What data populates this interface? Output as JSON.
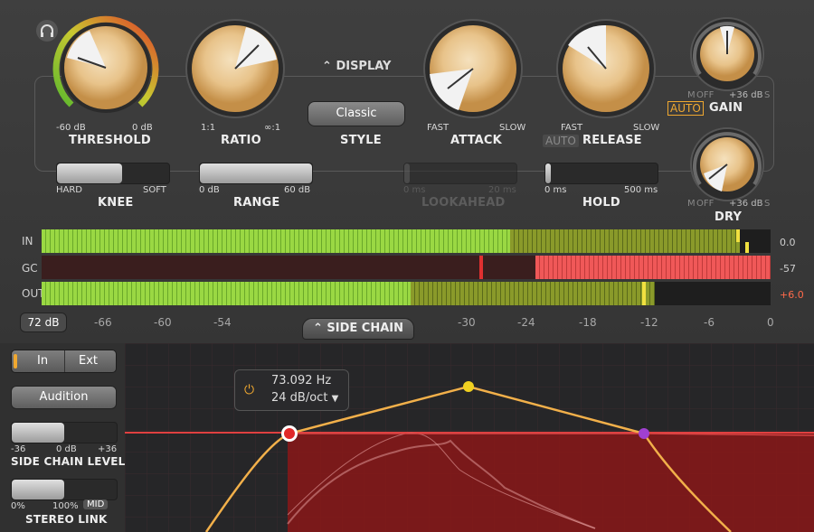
{
  "controls": {
    "threshold": {
      "label": "THRESHOLD",
      "min": "-60 dB",
      "max": "0 dB"
    },
    "ratio": {
      "label": "RATIO",
      "min": "1:1",
      "max": "∞:1"
    },
    "display_toggle": "DISPLAY",
    "style": {
      "label": "STYLE",
      "value": "Classic"
    },
    "attack": {
      "label": "ATTACK",
      "min": "FAST",
      "max": "SLOW"
    },
    "release": {
      "label": "RELEASE",
      "min": "FAST",
      "max": "SLOW",
      "auto": "AUTO"
    },
    "gain": {
      "label": "GAIN",
      "auto": "AUTO",
      "m": "M",
      "off": "OFF",
      "max": "+36 dB",
      "s": "S"
    },
    "dry": {
      "label": "DRY",
      "m": "M",
      "off": "OFF",
      "max": "+36 dB",
      "s": "S"
    },
    "knee": {
      "label": "KNEE",
      "min": "HARD",
      "max": "SOFT",
      "level": 0.6
    },
    "range": {
      "label": "RANGE",
      "min": "0 dB",
      "max": "60 dB",
      "level": 1.0
    },
    "lookahead": {
      "label": "LOOKAHEAD",
      "min": "0 ms",
      "max": "20 ms",
      "level": 0.0
    },
    "hold": {
      "label": "HOLD",
      "min": "0 ms",
      "max": "500 ms",
      "level": 0.0
    }
  },
  "meters": {
    "in": {
      "label": "IN",
      "value": "0.0",
      "level": 0.98
    },
    "gc": {
      "label": "GC",
      "value": "-57",
      "level": 0.57
    },
    "out": {
      "label": "OUT",
      "value": "+6.0",
      "level": 0.85
    },
    "range_button": "72 dB",
    "scale": [
      "-66",
      "-60",
      "-54",
      "-30",
      "-24",
      "-18",
      "-12",
      "-6",
      "0"
    ]
  },
  "side_chain": {
    "toggle": "SIDE CHAIN",
    "in": "In",
    "ext": "Ext",
    "audition": "Audition",
    "level": {
      "label": "SIDE CHAIN LEVEL",
      "min": "-36",
      "mid": "0 dB",
      "max": "+36"
    },
    "stereo": {
      "label": "STEREO LINK",
      "min": "0%",
      "max": "100%",
      "mid": "MID"
    },
    "filter": {
      "freq": "73.092 Hz",
      "slope": "24 dB/oct"
    }
  },
  "colors": {
    "accent": "#f0a830",
    "meter_green": "#8cd43a",
    "meter_red": "#e04646",
    "curve": "#f2b04a"
  }
}
